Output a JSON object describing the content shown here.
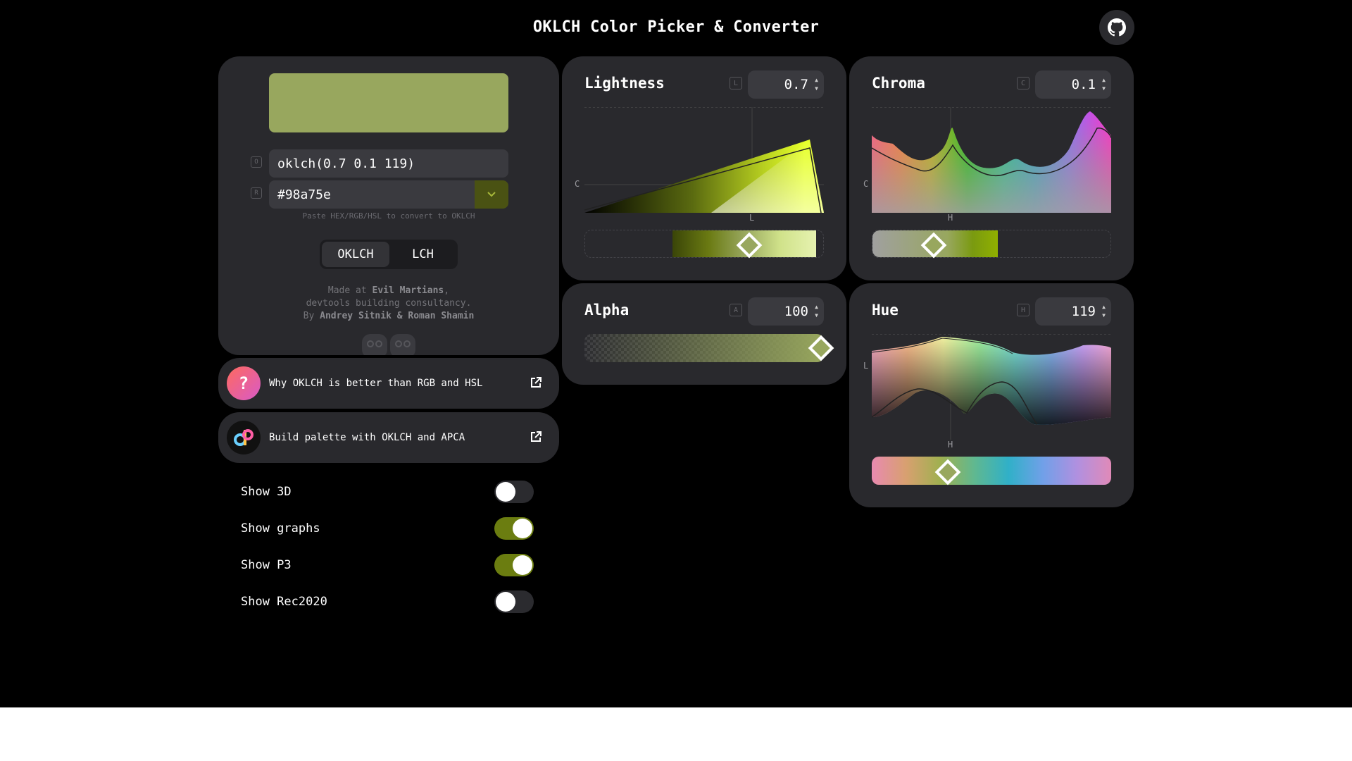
{
  "header": {
    "title": "OKLCH Color Picker & Converter",
    "github_icon": "github-icon"
  },
  "color": {
    "hex_value": "#98a75e"
  },
  "main": {
    "oklch_tag": "O",
    "oklch_value": "oklch(0.7 0.1 119)",
    "rgb_tag": "R",
    "hex_value": "#98a75e",
    "hint": "Paste HEX/RGB/HSL to convert to OKLCH",
    "space_oklch": "OKLCH",
    "space_lch": "LCH",
    "credit_line1_pre": "Made at ",
    "credit_company": "Evil Martians",
    "credit_line1_post": ",",
    "credit_line2": "devtools building consultancy.",
    "credit_line3_pre": "By ",
    "credit_authors": "Andrey Sitnik & Roman Shamin"
  },
  "links": [
    {
      "icon": "?",
      "label": "Why OKLCH is better than RGB and HSL"
    },
    {
      "icon": "dP",
      "label": "Build palette with OKLCH and APCA"
    }
  ],
  "settings": [
    {
      "label": "Show 3D",
      "enabled": false
    },
    {
      "label": "Show graphs",
      "enabled": true
    },
    {
      "label": "Show P3",
      "enabled": true
    },
    {
      "label": "Show Rec2020",
      "enabled": false
    }
  ],
  "channels": {
    "lightness": {
      "title": "Lightness",
      "tag": "L",
      "value": "0.7",
      "axis_x": "L",
      "axis_y": "C",
      "level": 0.7
    },
    "chroma": {
      "title": "Chroma",
      "tag": "C",
      "value": "0.1",
      "axis_x": "H",
      "axis_y": "C",
      "level": 0.27
    },
    "alpha": {
      "title": "Alpha",
      "tag": "A",
      "value": "100",
      "level": 1.0
    },
    "hue": {
      "title": "Hue",
      "tag": "H",
      "value": "119",
      "axis_x": "H",
      "axis_y": "L",
      "level": 0.33
    }
  },
  "accent_color": "#98a75e",
  "toggle_on_color": "#6b7d10"
}
